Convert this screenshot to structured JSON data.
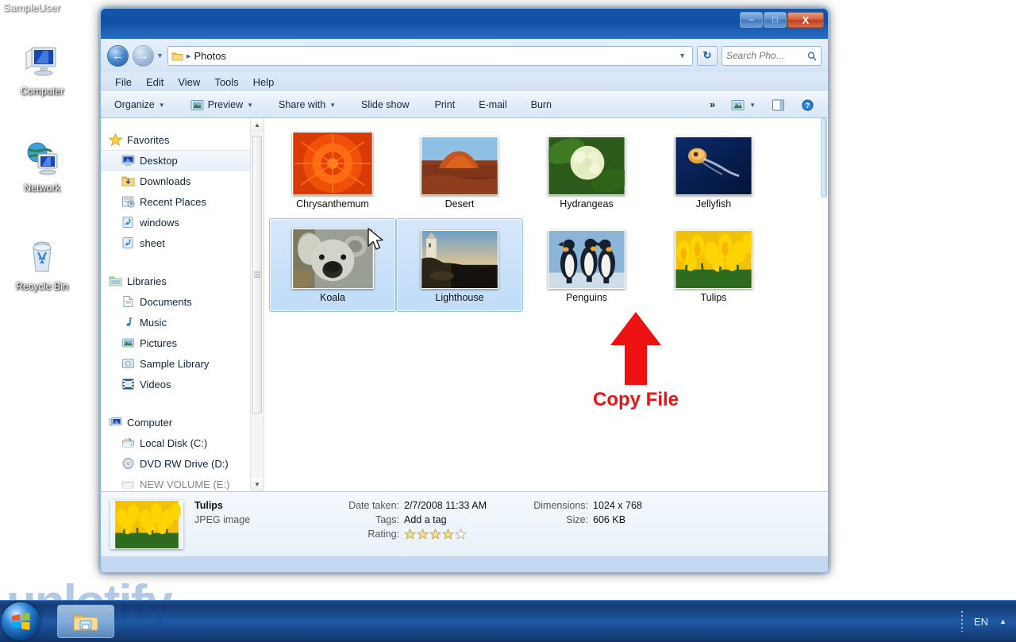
{
  "desktop": {
    "user_label": "SampleUser",
    "icons": [
      {
        "label": "Computer",
        "icon": "computer-icon"
      },
      {
        "label": "Network",
        "icon": "network-icon"
      },
      {
        "label": "Recycle Bin",
        "icon": "recycle-bin-icon"
      }
    ],
    "watermark": "unlotify"
  },
  "window": {
    "controls": {
      "minimize": "–",
      "maximize": "□",
      "close": "X"
    },
    "address": {
      "back_icon": "back-arrow-icon",
      "forward_icon": "forward-arrow-icon",
      "history_caret": "▼",
      "folder_icon": "folder-icon",
      "separator": "▸",
      "crumb": "Photos",
      "dropdown_caret": "▼",
      "refresh_icon": "refresh-icon"
    },
    "search": {
      "placeholder": "Search Pho...",
      "icon": "search-icon"
    },
    "menubar": [
      "File",
      "Edit",
      "View",
      "Tools",
      "Help"
    ],
    "commandbar": {
      "items": [
        {
          "label": "Organize",
          "caret": "▼",
          "icon": null
        },
        {
          "label": "Preview",
          "caret": "▼",
          "icon": "preview-icon"
        },
        {
          "label": "Share with",
          "caret": "▼",
          "icon": null
        },
        {
          "label": "Slide show",
          "caret": "",
          "icon": null
        },
        {
          "label": "Print",
          "caret": "",
          "icon": null
        },
        {
          "label": "E-mail",
          "caret": "",
          "icon": null
        },
        {
          "label": "Burn",
          "caret": "",
          "icon": null
        }
      ],
      "overflow": "»",
      "view_icon": "change-view-icon",
      "view_caret": "▼",
      "pane_icon": "show-preview-pane-icon",
      "help_icon": "help-icon"
    }
  },
  "navpane": {
    "groups": [
      {
        "header": {
          "label": "Favorites",
          "icon": "star-icon"
        },
        "items": [
          {
            "label": "Desktop",
            "icon": "desktop-icon",
            "selected": true
          },
          {
            "label": "Downloads",
            "icon": "downloads-icon",
            "selected": false
          },
          {
            "label": "Recent Places",
            "icon": "recent-places-icon",
            "selected": false
          },
          {
            "label": "windows",
            "icon": "shortcut-icon",
            "selected": false
          },
          {
            "label": "sheet",
            "icon": "shortcut-icon",
            "selected": false
          }
        ]
      },
      {
        "header": {
          "label": "Libraries",
          "icon": "libraries-icon"
        },
        "items": [
          {
            "label": "Documents",
            "icon": "documents-icon",
            "selected": false
          },
          {
            "label": "Music",
            "icon": "music-icon",
            "selected": false
          },
          {
            "label": "Pictures",
            "icon": "pictures-icon",
            "selected": false
          },
          {
            "label": "Sample Library",
            "icon": "library-icon",
            "selected": false
          },
          {
            "label": "Videos",
            "icon": "videos-icon",
            "selected": false
          }
        ]
      },
      {
        "header": {
          "label": "Computer",
          "icon": "computer-small-icon"
        },
        "items": [
          {
            "label": "Local Disk (C:)",
            "icon": "hdd-system-icon",
            "selected": false
          },
          {
            "label": "DVD RW Drive (D:)",
            "icon": "dvd-icon",
            "selected": false
          },
          {
            "label": "NEW VOLUME (E:)",
            "icon": "hdd-icon",
            "selected": false
          }
        ]
      }
    ],
    "scroll_up": "▲",
    "scroll_down": "▼"
  },
  "files": [
    {
      "name": "Chrysanthemum",
      "selected": false,
      "thumb": "chrysanthemum"
    },
    {
      "name": "Desert",
      "selected": false,
      "thumb": "desert"
    },
    {
      "name": "Hydrangeas",
      "selected": false,
      "thumb": "hydrangeas"
    },
    {
      "name": "Jellyfish",
      "selected": false,
      "thumb": "jellyfish"
    },
    {
      "name": "Koala",
      "selected": true,
      "thumb": "koala"
    },
    {
      "name": "Lighthouse",
      "selected": true,
      "thumb": "lighthouse"
    },
    {
      "name": "Penguins",
      "selected": false,
      "thumb": "penguins"
    },
    {
      "name": "Tulips",
      "selected": false,
      "thumb": "tulips"
    }
  ],
  "annotation": {
    "label": "Copy File",
    "arrow": "up-arrow-annotation",
    "color": "#ee1111"
  },
  "details": {
    "title": "Tulips",
    "type": "JPEG image",
    "fields": [
      {
        "key": "Date taken:",
        "value": "2/7/2008 11:33 AM"
      },
      {
        "key": "Tags:",
        "value": "Add a tag"
      },
      {
        "key": "Rating:",
        "value": ""
      },
      {
        "key": "Dimensions:",
        "value": "1024 x 768"
      },
      {
        "key": "Size:",
        "value": "606 KB"
      }
    ],
    "rating": {
      "filled": 4,
      "total": 5
    }
  },
  "taskbar": {
    "start_icon": "windows-start-orb",
    "items": [
      {
        "icon": "windows-explorer-icon",
        "label": ""
      }
    ],
    "language": "EN",
    "show_hidden_icons": "▲"
  }
}
